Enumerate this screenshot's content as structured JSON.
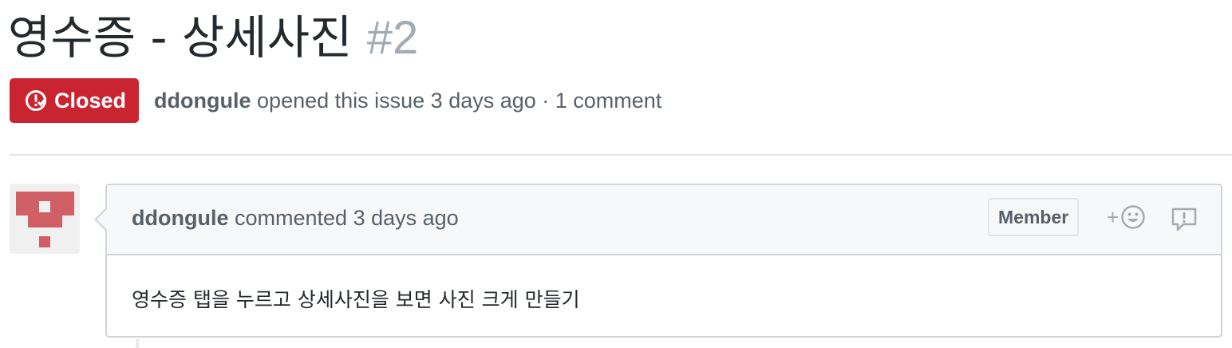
{
  "issue": {
    "title": "영수증 - 상세사진",
    "number": "#2",
    "state": "Closed",
    "state_color": "#cb2431",
    "author": "ddongule",
    "meta": "opened this issue 3 days ago · 1 comment"
  },
  "comment": {
    "author": "ddongule",
    "action": "commented 3 days ago",
    "role_badge": "Member",
    "reaction_plus": "+",
    "body": "영수증 탭을 누르고 상세사진을 보면 사진 크게 만들기",
    "avatar_color": "#d05f66"
  },
  "icons": {
    "state": "issue-closed-icon",
    "reaction": "smiley-icon",
    "more": "report-icon"
  }
}
